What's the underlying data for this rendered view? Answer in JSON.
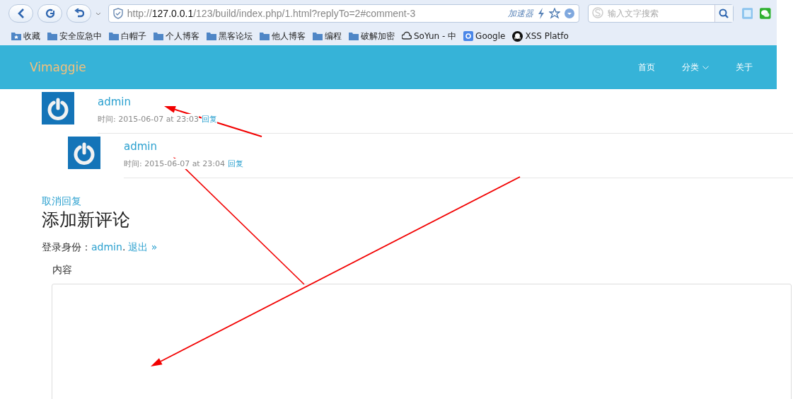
{
  "browser": {
    "address": {
      "scheme": "http://",
      "host": "127.0.0.1",
      "path": "/123/build/index.php/1.html?replyTo=2#comment-3"
    },
    "accelerator": "加速器",
    "search": {
      "placeholder": "输入文字搜索"
    },
    "bookmarks": [
      {
        "label": "收藏",
        "kind": "favorites"
      },
      {
        "label": "安全应急中",
        "kind": "folder"
      },
      {
        "label": "白帽子",
        "kind": "folder"
      },
      {
        "label": "个人博客",
        "kind": "folder"
      },
      {
        "label": "黑客论坛",
        "kind": "folder"
      },
      {
        "label": "他人博客",
        "kind": "folder"
      },
      {
        "label": "编程",
        "kind": "folder"
      },
      {
        "label": "破解加密",
        "kind": "folder"
      },
      {
        "label": "SoYun - 中",
        "kind": "cloud"
      },
      {
        "label": "Google",
        "kind": "google"
      },
      {
        "label": "XSS Platfo",
        "kind": "skull"
      }
    ]
  },
  "site": {
    "logo": "Vimaggie",
    "nav": [
      {
        "label": "首页",
        "dropdown": false
      },
      {
        "label": "分类",
        "dropdown": true
      },
      {
        "label": "关于",
        "dropdown": false
      }
    ],
    "comments": [
      {
        "author": "admin",
        "time": "时间: 2015-06-07 at 23:03",
        "reply": "回复",
        "children": [
          {
            "author": "admin",
            "time": "时间: 2015-06-07 at 23:04",
            "reply": "回复"
          }
        ]
      }
    ],
    "cancel_reply": "取消回复",
    "form_title": "添加新评论",
    "login_prefix": "登录身份：",
    "login_user": "admin",
    "login_sep": ".",
    "logout": "退出 »",
    "content_label": "内容"
  }
}
